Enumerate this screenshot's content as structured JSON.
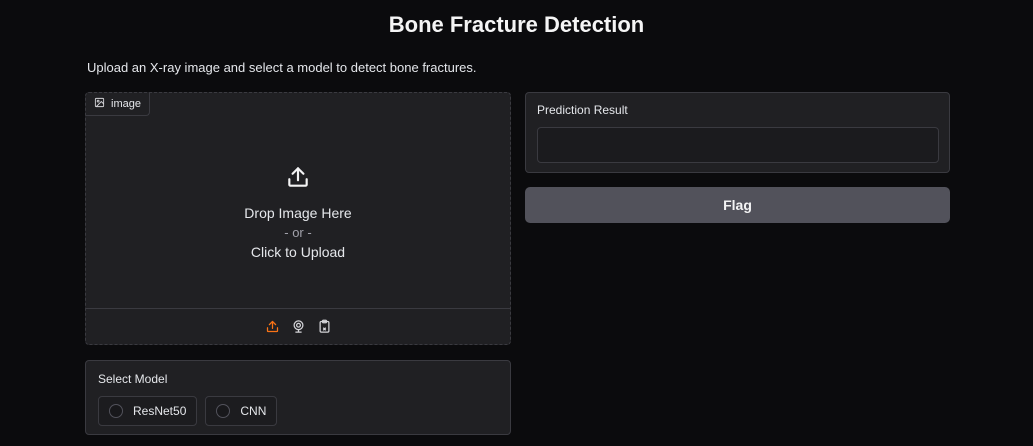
{
  "header": {
    "title": "Bone Fracture Detection",
    "description": "Upload an X-ray image and select a model to detect bone fractures."
  },
  "image_input": {
    "label": "image",
    "label_icon": "image-icon",
    "drop_text": "Drop Image Here",
    "or_text": "- or -",
    "click_text": "Click to Upload",
    "sources": [
      {
        "name": "upload",
        "icon": "upload-icon",
        "active": true
      },
      {
        "name": "webcam",
        "icon": "webcam-icon",
        "active": false
      },
      {
        "name": "clipboard",
        "icon": "clipboard-icon",
        "active": false
      }
    ]
  },
  "model_select": {
    "label": "Select Model",
    "options": [
      "ResNet50",
      "CNN"
    ],
    "selected": null
  },
  "result": {
    "label": "Prediction Result",
    "value": ""
  },
  "flag": {
    "label": "Flag"
  },
  "colors": {
    "background": "#0b0b0d",
    "panel": "#202023",
    "border": "#3a3a40",
    "accent": "#f97316",
    "button": "#52525b"
  }
}
